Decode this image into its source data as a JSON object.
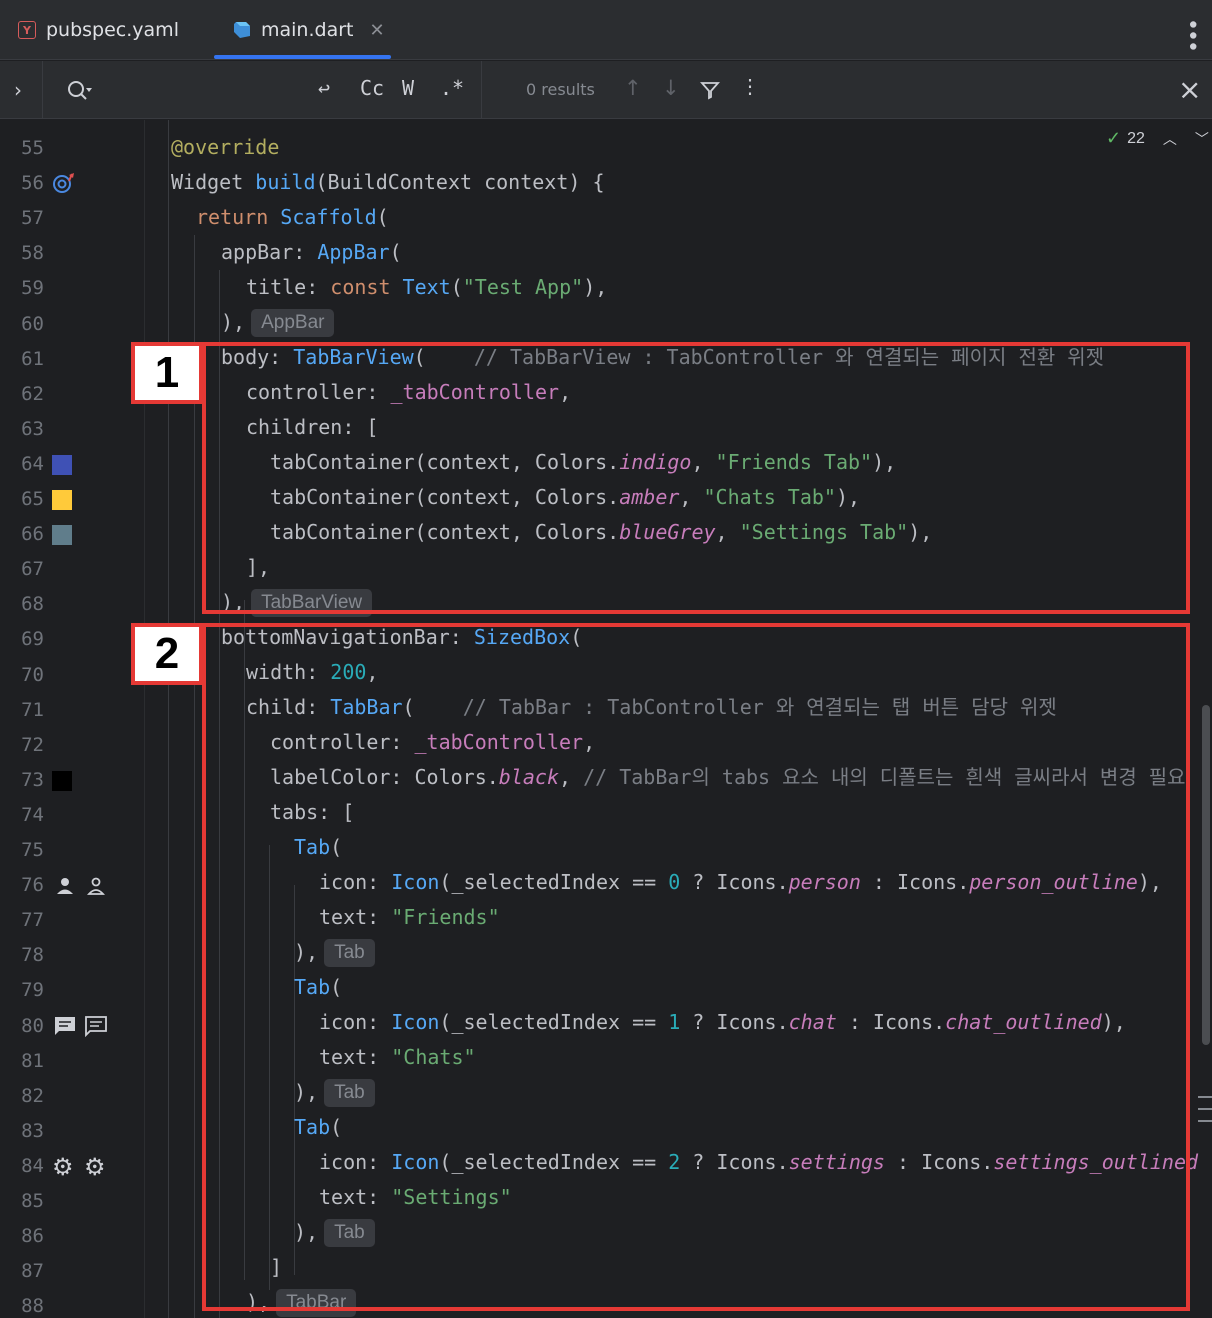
{
  "tabs": [
    {
      "label": "pubspec.yaml",
      "icon": "yaml-file-icon"
    },
    {
      "label": "main.dart",
      "icon": "dart-file-icon",
      "active": true
    }
  ],
  "search": {
    "results": "0 results",
    "case_label": "Cc",
    "word_label": "W",
    "regex_label": ".*"
  },
  "inspections": {
    "count": "22"
  },
  "gutter": {
    "line_numbers": [
      "55",
      "56",
      "57",
      "58",
      "59",
      "60",
      "61",
      "62",
      "63",
      "64",
      "65",
      "66",
      "67",
      "68",
      "69",
      "70",
      "71",
      "72",
      "73",
      "74",
      "75",
      "76",
      "77",
      "78",
      "79",
      "80",
      "81",
      "82",
      "83",
      "84",
      "85",
      "86",
      "87",
      "88"
    ],
    "color_swatches": {
      "64": "#3f51b5",
      "65": "#ffca3a",
      "66": "#607d8b",
      "73": "#000000"
    }
  },
  "code": {
    "l55": "@override",
    "l56": [
      "Widget ",
      "build",
      "(BuildContext context) {"
    ],
    "l57": [
      "return ",
      "Scaffold",
      "("
    ],
    "l58": [
      "appBar: ",
      "AppBar",
      "("
    ],
    "l59": [
      "title: ",
      "const ",
      "Text",
      "(",
      "\"Test App\"",
      "),"
    ],
    "l60": [
      "),",
      "AppBar"
    ],
    "l61": [
      "body: ",
      "TabBarView",
      "(",
      "// TabBarView : TabController 와 연결되는 페이지 전환 위젯"
    ],
    "l62": [
      "controller: ",
      "_tabController",
      ","
    ],
    "l63": "children: [",
    "l64": [
      "tabContainer(context, Colors.",
      "indigo",
      ", ",
      "\"Friends Tab\"",
      "),"
    ],
    "l65": [
      "tabContainer(context, Colors.",
      "amber",
      ", ",
      "\"Chats Tab\"",
      "),"
    ],
    "l66": [
      "tabContainer(context, Colors.",
      "blueGrey",
      ", ",
      "\"Settings Tab\"",
      "),"
    ],
    "l67": "],",
    "l68": [
      "),",
      "TabBarView"
    ],
    "l69": [
      "bottomNavigationBar: ",
      "SizedBox",
      "("
    ],
    "l70": [
      "width: ",
      "200",
      ","
    ],
    "l71": [
      "child: ",
      "TabBar",
      "(",
      "// TabBar : TabController 와 연결되는 탭 버튼 담당 위젯"
    ],
    "l72": [
      "controller: ",
      "_tabController",
      ","
    ],
    "l73": [
      "labelColor: Colors.",
      "black",
      ", ",
      "// TabBar의 tabs 요소 내의 디폴트는 흰색 글씨라서 변경 필요"
    ],
    "l74": "tabs: [",
    "l75": [
      "Tab",
      "("
    ],
    "l76": [
      "icon: ",
      "Icon",
      "(_selectedIndex == ",
      "0",
      " ? Icons.",
      "person",
      " : Icons.",
      "person_outline",
      "),"
    ],
    "l77": [
      "text: ",
      "\"Friends\""
    ],
    "l78": [
      "),",
      "Tab"
    ],
    "l79": [
      "Tab",
      "("
    ],
    "l80": [
      "icon: ",
      "Icon",
      "(_selectedIndex == ",
      "1",
      " ? Icons.",
      "chat",
      " : Icons.",
      "chat_outlined",
      "),"
    ],
    "l81": [
      "text: ",
      "\"Chats\""
    ],
    "l82": [
      "),",
      "Tab"
    ],
    "l83": [
      "Tab",
      "("
    ],
    "l84": [
      "icon: ",
      "Icon",
      "(_selectedIndex == ",
      "2",
      " ? Icons.",
      "settings",
      " : Icons.",
      "settings_outlined"
    ],
    "l85": [
      "text: ",
      "\"Settings\""
    ],
    "l86": [
      "),",
      "Tab"
    ],
    "l87": "]",
    "l88": [
      "),",
      "TabBar"
    ]
  },
  "annotations": {
    "box1_label": "1",
    "box2_label": "2",
    "color": "#e53935"
  }
}
